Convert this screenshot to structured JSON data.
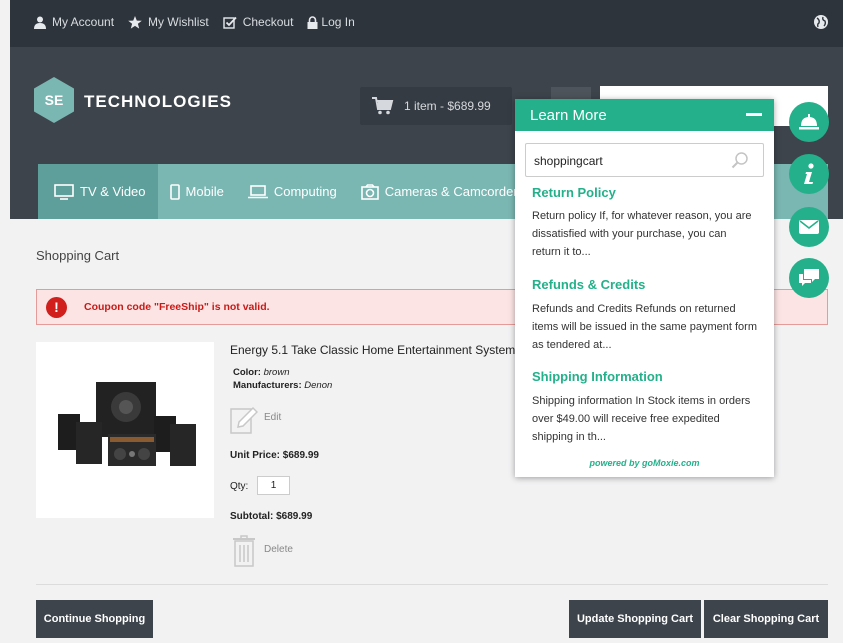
{
  "topbar": {
    "links": [
      "My Account",
      "My Wishlist",
      "Checkout",
      "Log In"
    ]
  },
  "header": {
    "logo_mark": "SE",
    "logo_text": "TECHNOLOGIES",
    "cart_summary": "1 item - $689.99"
  },
  "nav": {
    "items": [
      "TV & Video",
      "Mobile",
      "Computing",
      "Cameras & Camcorders"
    ]
  },
  "page": {
    "title": "Shopping Cart",
    "alert": "Coupon code \"FreeShip\" is not valid."
  },
  "product": {
    "name": "Energy 5.1 Take Classic Home Entertainment System",
    "color_label": "Color:",
    "color_value": "brown",
    "manufacturer_label": "Manufacturers:",
    "manufacturer_value": "Denon",
    "edit_label": "Edit",
    "unit_price": "Unit Price: $689.99",
    "qty_label": "Qty:",
    "qty_value": "1",
    "subtotal": "Subtotal: $689.99",
    "delete_label": "Delete"
  },
  "buttons": {
    "continue": "Continue Shopping",
    "update": "Update Shopping Cart",
    "clear": "Clear Shopping Cart"
  },
  "learn_more": {
    "title": "Learn More",
    "search_value": "shoppingcart",
    "results": [
      {
        "title": "Return Policy",
        "body": "Return policy If, for whatever reason, you are dissatisfied with your purchase, you can return it to..."
      },
      {
        "title": "Refunds & Credits",
        "body": "Refunds and Credits Refunds on returned items will be issued in the same payment form as tendered at..."
      },
      {
        "title": "Shipping Information",
        "body": "Shipping information In Stock items in orders over $49.00 will receive free expedited shipping in th..."
      }
    ],
    "powered_prefix": "powered by",
    "powered_brand": "goMoxie.com"
  },
  "colors": {
    "accent": "#24b08a",
    "nav": "#7ab6b2",
    "dark": "#3d444b"
  }
}
